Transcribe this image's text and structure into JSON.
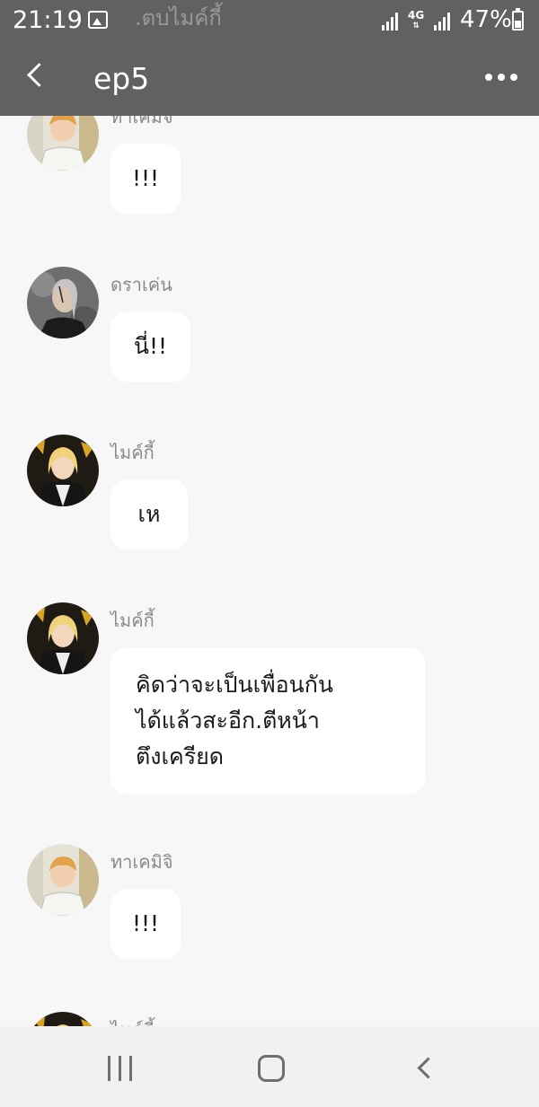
{
  "status_bar": {
    "time": "21:19",
    "network_type": "4G",
    "battery_percent": "47%",
    "battery_level": 0.47,
    "behind_text": ".ตบไมค์กี้"
  },
  "header": {
    "title": "ep5",
    "back_icon": "chevron-left-icon",
    "more_icon": "more-horizontal-icon"
  },
  "messages": [
    {
      "sender": "ทาเคมิจิ",
      "text": "!!!",
      "avatar": "takemichi-avatar"
    },
    {
      "sender": "ดราเค่น",
      "text": "นี่!!",
      "avatar": "draken-avatar"
    },
    {
      "sender": "ไมค์กี้",
      "text": "เห",
      "avatar": "mikey-avatar"
    },
    {
      "sender": "ไมค์กี้",
      "text": "คิดว่าจะเป็นเพื่อนกัน\nได้แล้วสะอีก.ตีหน้า\nตึงเครียด",
      "avatar": "mikey-avatar"
    },
    {
      "sender": "ทาเคมิจิ",
      "text": "!!!",
      "avatar": "takemichi-avatar"
    },
    {
      "sender": "ไมค์กี้",
      "text": "",
      "avatar": "mikey-avatar"
    }
  ],
  "nav_bar": {
    "recent_icon": "recent-apps-icon",
    "home_icon": "home-icon",
    "back_icon": "back-icon"
  },
  "colors": {
    "header_bg": "#616161",
    "chat_bg": "#f7f7f7",
    "bubble_bg": "#ffffff",
    "sender_text": "#8a8a8a"
  }
}
